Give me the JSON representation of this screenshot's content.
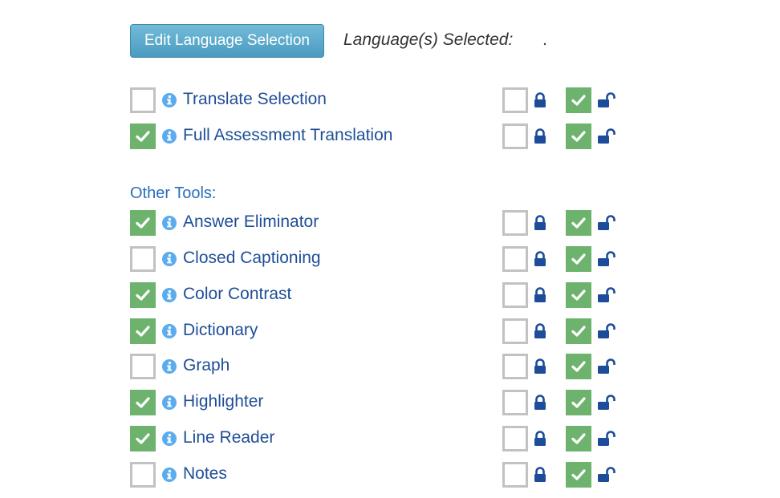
{
  "header": {
    "edit_button_label": "Edit Language Selection",
    "languages_selected_label": "Language(s) Selected:",
    "languages_selected_value": "."
  },
  "colors": {
    "checked_green": "#6db36d",
    "label_blue": "#1f4e96",
    "section_blue": "#2a6ebd",
    "info_icon_blue": "#5aacef",
    "lock_blue": "#1d4c9a",
    "unchecked_border": "#c2c2c2"
  },
  "translation_tools": [
    {
      "label": "Translate Selection",
      "enabled": false,
      "locked": false,
      "unlocked": true
    },
    {
      "label": "Full Assessment Translation",
      "enabled": true,
      "locked": false,
      "unlocked": true
    }
  ],
  "other_tools": {
    "title": "Other Tools:",
    "items": [
      {
        "label": "Answer Eliminator",
        "enabled": true,
        "locked": false,
        "unlocked": true
      },
      {
        "label": "Closed Captioning",
        "enabled": false,
        "locked": false,
        "unlocked": true
      },
      {
        "label": "Color Contrast",
        "enabled": true,
        "locked": false,
        "unlocked": true
      },
      {
        "label": "Dictionary",
        "enabled": true,
        "locked": false,
        "unlocked": true
      },
      {
        "label": "Graph",
        "enabled": false,
        "locked": false,
        "unlocked": true
      },
      {
        "label": "Highlighter",
        "enabled": true,
        "locked": false,
        "unlocked": true
      },
      {
        "label": "Line Reader",
        "enabled": true,
        "locked": false,
        "unlocked": true
      },
      {
        "label": "Notes",
        "enabled": false,
        "locked": false,
        "unlocked": true
      }
    ]
  },
  "icons": {
    "info": "info-circle-icon",
    "lock": "lock-closed-icon",
    "unlock": "lock-open-icon",
    "check": "checkmark-icon"
  }
}
